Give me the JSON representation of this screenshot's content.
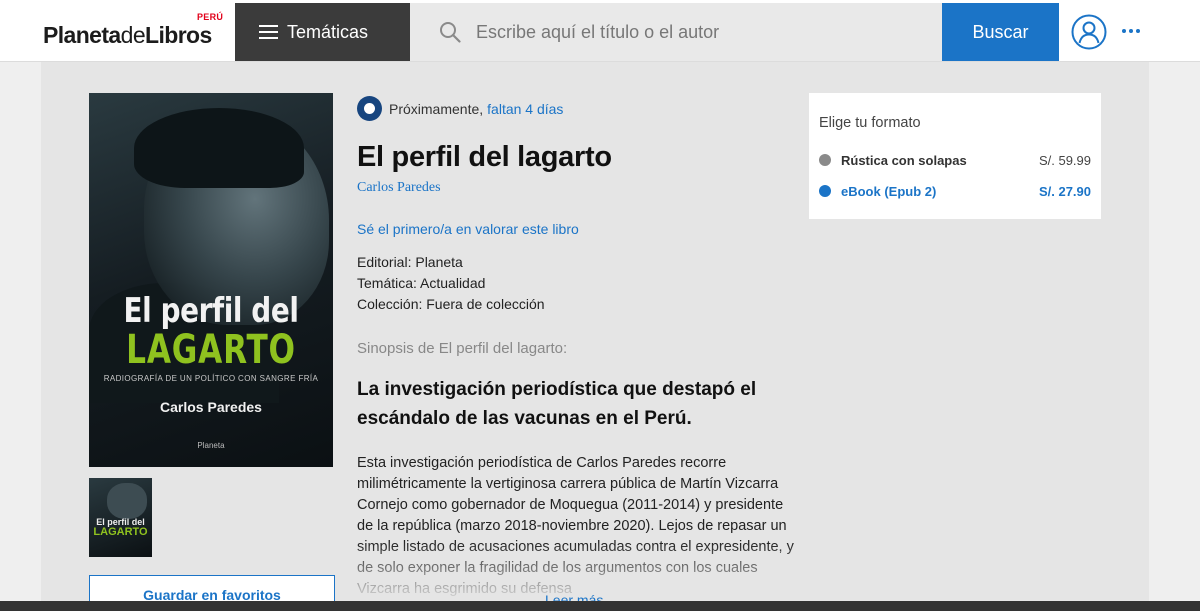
{
  "header": {
    "logo_main": "Planeta",
    "logo_de": "de",
    "logo_end": "Libros",
    "logo_country": "PERÚ",
    "tematicas_label": "Temáticas",
    "search_placeholder": "Escribe aquí el título o el autor",
    "search_button": "Buscar",
    "icons": [
      "menu-icon",
      "search-icon",
      "user-icon",
      "more-icon"
    ],
    "accent_color": "#1b74c7"
  },
  "cover": {
    "title_line1": "El perfil del",
    "title_line2": "LAGARTO",
    "subtitle": "RADIOGRAFÍA DE UN POLÍTICO CON SANGRE FRÍA",
    "author": "Carlos Paredes",
    "publisher": "Planeta",
    "thumb_line1": "El perfil del",
    "thumb_line2": "LAGARTO"
  },
  "actions": {
    "favorite_button": "Guardar en favoritos",
    "read_more": "Leer más"
  },
  "book": {
    "availability_prefix": "Próximamente,",
    "availability_days": "faltan 4 días",
    "title": "El perfil del lagarto",
    "author": "Carlos Paredes",
    "rate_link": "Sé el primero/a en valorar este libro",
    "editorial": "Editorial: Planeta",
    "tematica": "Temática: Actualidad",
    "coleccion": "Colección: Fuera de colección",
    "synopsis_label": "Sinopsis de El perfil del lagarto:",
    "synopsis_headline": "La investigación periodística que destapó el escándalo de las vacunas en el Perú.",
    "synopsis_body": "Esta investigación periodística de Carlos Paredes recorre milimétricamente la vertiginosa carrera pública de Martín Vizcarra Cornejo como gobernador de Moquegua (2011-2014) y presidente de la república (marzo 2018-noviembre 2020). Lejos de repasar un simple listado de acusaciones acumuladas contra el expresidente, y de solo exponer la fragilidad de los argumentos con los cuales Vizcarra ha esgrimido su defensa"
  },
  "formats": {
    "title": "Elige tu formato",
    "options": [
      {
        "name": "Rústica con solapas",
        "price": "S/. 59.99",
        "color": "#8a8a8a"
      },
      {
        "name": "eBook (Epub 2)",
        "price": "S/. 27.90",
        "color": "#1b74c7"
      }
    ]
  }
}
